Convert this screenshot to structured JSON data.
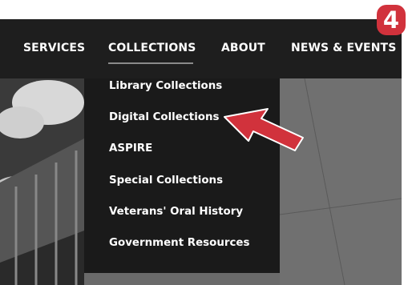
{
  "nav": {
    "items": [
      {
        "label": "SERVICES"
      },
      {
        "label": "COLLECTIONS"
      },
      {
        "label": "ABOUT"
      },
      {
        "label": "NEWS & EVENTS"
      }
    ],
    "active": "COLLECTIONS"
  },
  "dropdown": {
    "items": [
      {
        "label": "Library Collections"
      },
      {
        "label": "Digital Collections"
      },
      {
        "label": "ASPIRE"
      },
      {
        "label": "Special Collections"
      },
      {
        "label": "Veterans' Oral History"
      },
      {
        "label": "Government Resources"
      }
    ],
    "highlighted": "Digital Collections"
  },
  "badge": {
    "number": "4",
    "color": "#d1323c"
  },
  "annotation": {
    "arrow_color": "#d1323c",
    "points_to": "Digital Collections"
  },
  "colors": {
    "nav_bg": "#1e1e1e",
    "dropdown_bg": "#1a1a1a",
    "text": "#ffffff"
  }
}
